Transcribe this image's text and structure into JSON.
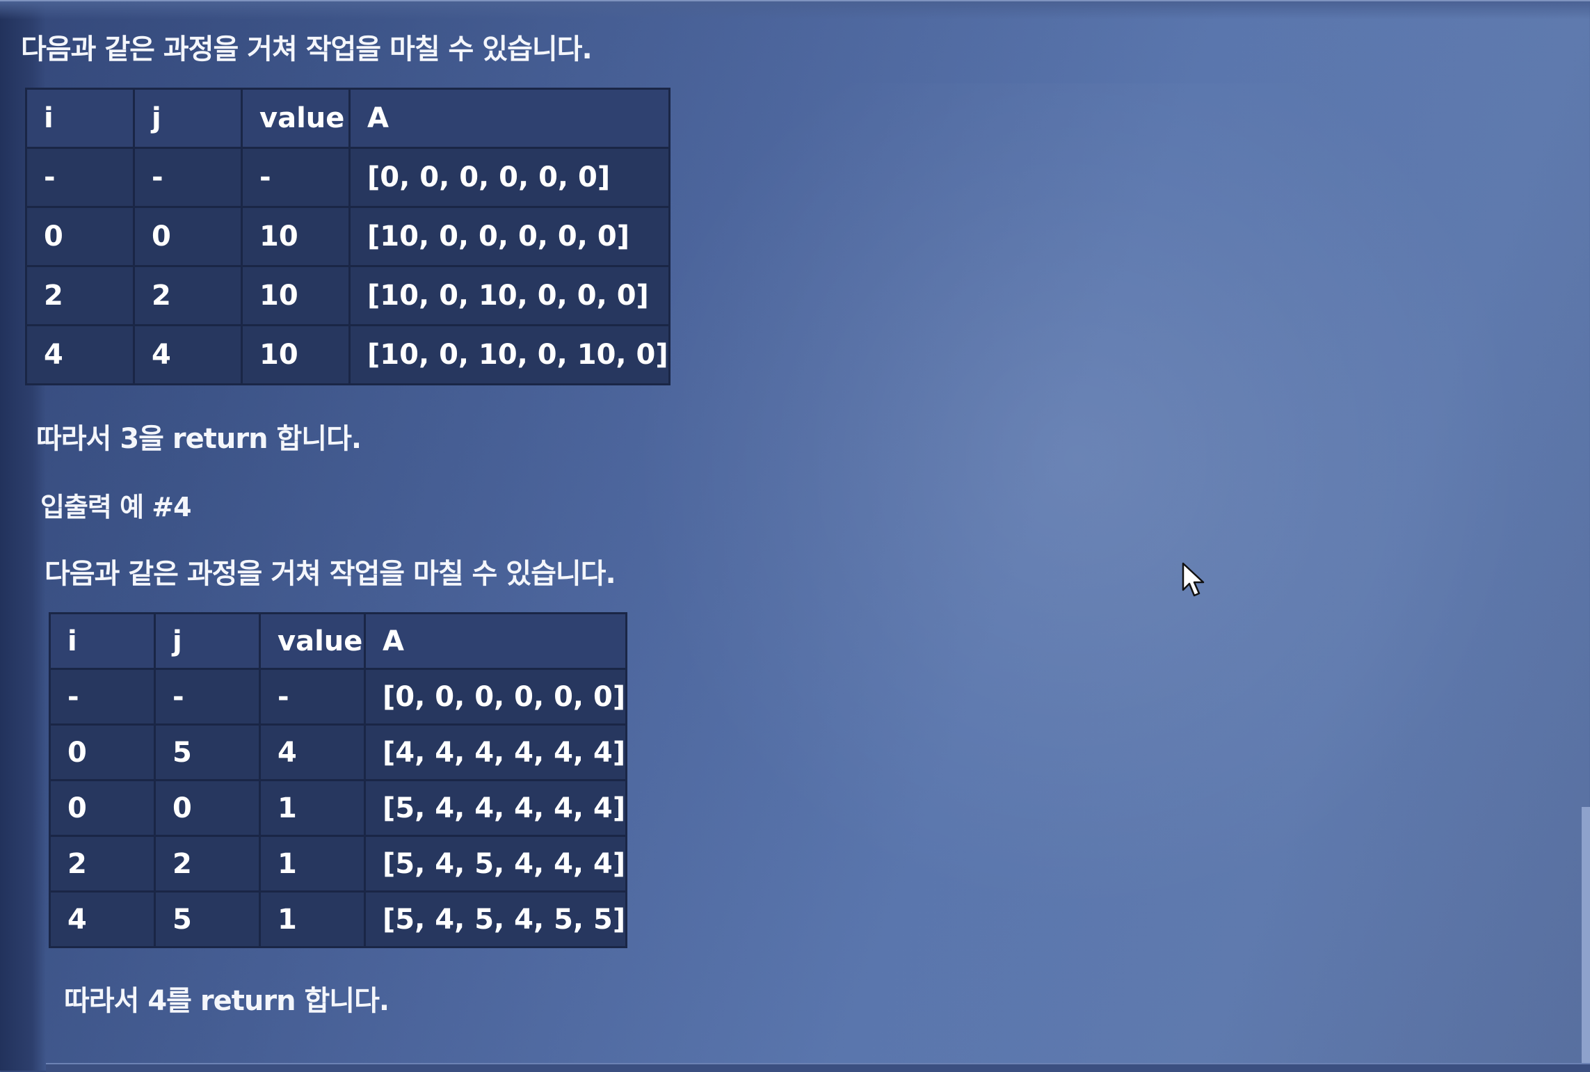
{
  "section1": {
    "intro": "다음과 같은 과정을 거쳐 작업을 마칠 수 있습니다.",
    "table": {
      "headers": [
        "i",
        "j",
        "value",
        "A"
      ],
      "rows": [
        [
          "-",
          "-",
          "-",
          "[0, 0, 0, 0, 0, 0]"
        ],
        [
          "0",
          "0",
          "10",
          "[10, 0, 0, 0, 0, 0]"
        ],
        [
          "2",
          "2",
          "10",
          "[10, 0, 10, 0, 0, 0]"
        ],
        [
          "4",
          "4",
          "10",
          "[10, 0, 10, 0, 10, 0]"
        ]
      ]
    },
    "conclusion": "따라서 3을 return 합니다."
  },
  "section2": {
    "heading": "입출력 예 #4",
    "intro": "다음과 같은 과정을 거쳐 작업을 마칠 수 있습니다.",
    "table": {
      "headers": [
        "i",
        "j",
        "value",
        "A"
      ],
      "rows": [
        [
          "-",
          "-",
          "-",
          "[0, 0, 0, 0, 0, 0]"
        ],
        [
          "0",
          "5",
          "4",
          "[4, 4, 4, 4, 4, 4]"
        ],
        [
          "0",
          "0",
          "1",
          "[5, 4, 4, 4, 4, 4]"
        ],
        [
          "2",
          "2",
          "1",
          "[5, 4, 5, 4, 4, 4]"
        ],
        [
          "4",
          "5",
          "1",
          "[5, 4, 5, 4, 5, 5]"
        ]
      ]
    },
    "conclusion": "따라서 4를 return 합니다."
  },
  "icons": {
    "cursor": "mouse-pointer-icon"
  },
  "colors": {
    "background": "#4c659c",
    "table_background": "#27375f",
    "table_border": "#1a2646",
    "text": "#f4f6fb"
  }
}
